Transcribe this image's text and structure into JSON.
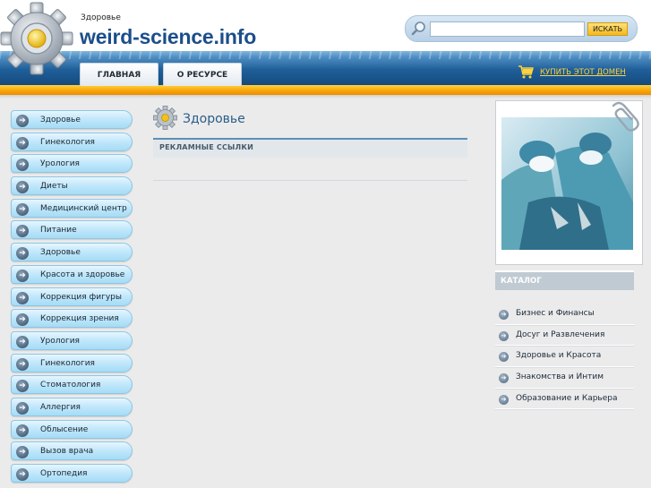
{
  "header": {
    "site_subtitle": "Здоровье",
    "site_name": "weird-science.info",
    "search": {
      "placeholder": "",
      "value": "",
      "button_label": "ИСКАТЬ"
    },
    "tabs": [
      {
        "label": "ГЛАВНАЯ"
      },
      {
        "label": "О РЕСУРСЕ"
      }
    ],
    "buy_domain_label": "КУПИТЬ ЭТОТ ДОМЕН"
  },
  "left_menu": {
    "items": [
      {
        "label": "Здоровье"
      },
      {
        "label": "Гинекология"
      },
      {
        "label": "Урология"
      },
      {
        "label": "Диеты"
      },
      {
        "label": "Медицинский центр"
      },
      {
        "label": "Питание"
      },
      {
        "label": "Здоровье"
      },
      {
        "label": "Красота и здоровье"
      },
      {
        "label": "Коррекция фигуры"
      },
      {
        "label": "Коррекция зрения"
      },
      {
        "label": "Урология"
      },
      {
        "label": "Гинекология"
      },
      {
        "label": "Стоматология"
      },
      {
        "label": "Аллергия"
      },
      {
        "label": "Облысение"
      },
      {
        "label": "Вызов врача"
      },
      {
        "label": "Ортопедия"
      }
    ]
  },
  "main": {
    "page_title": "Здоровье",
    "ads_label": "РЕКЛАМНЫЕ ССЫЛКИ"
  },
  "catalog": {
    "heading": "КАТАЛОГ",
    "items": [
      {
        "label": "Бизнес и Финансы"
      },
      {
        "label": "Досуг и Развлечения"
      },
      {
        "label": "Здоровье и Красота"
      },
      {
        "label": "Знакомства и Интим"
      },
      {
        "label": "Образование и Карьера"
      }
    ]
  },
  "colors": {
    "accent_blue": "#1b4e8a",
    "header_band": "#1f5f99",
    "orange_stripe": "#f7a70a",
    "menu_button": "#c3e8fb",
    "background": "#ebebeb"
  },
  "icons": [
    "gear-logo-icon",
    "search-magnifier-icon",
    "shopping-cart-icon",
    "arrow-right-icon",
    "paperclip-icon",
    "gear-icon"
  ]
}
